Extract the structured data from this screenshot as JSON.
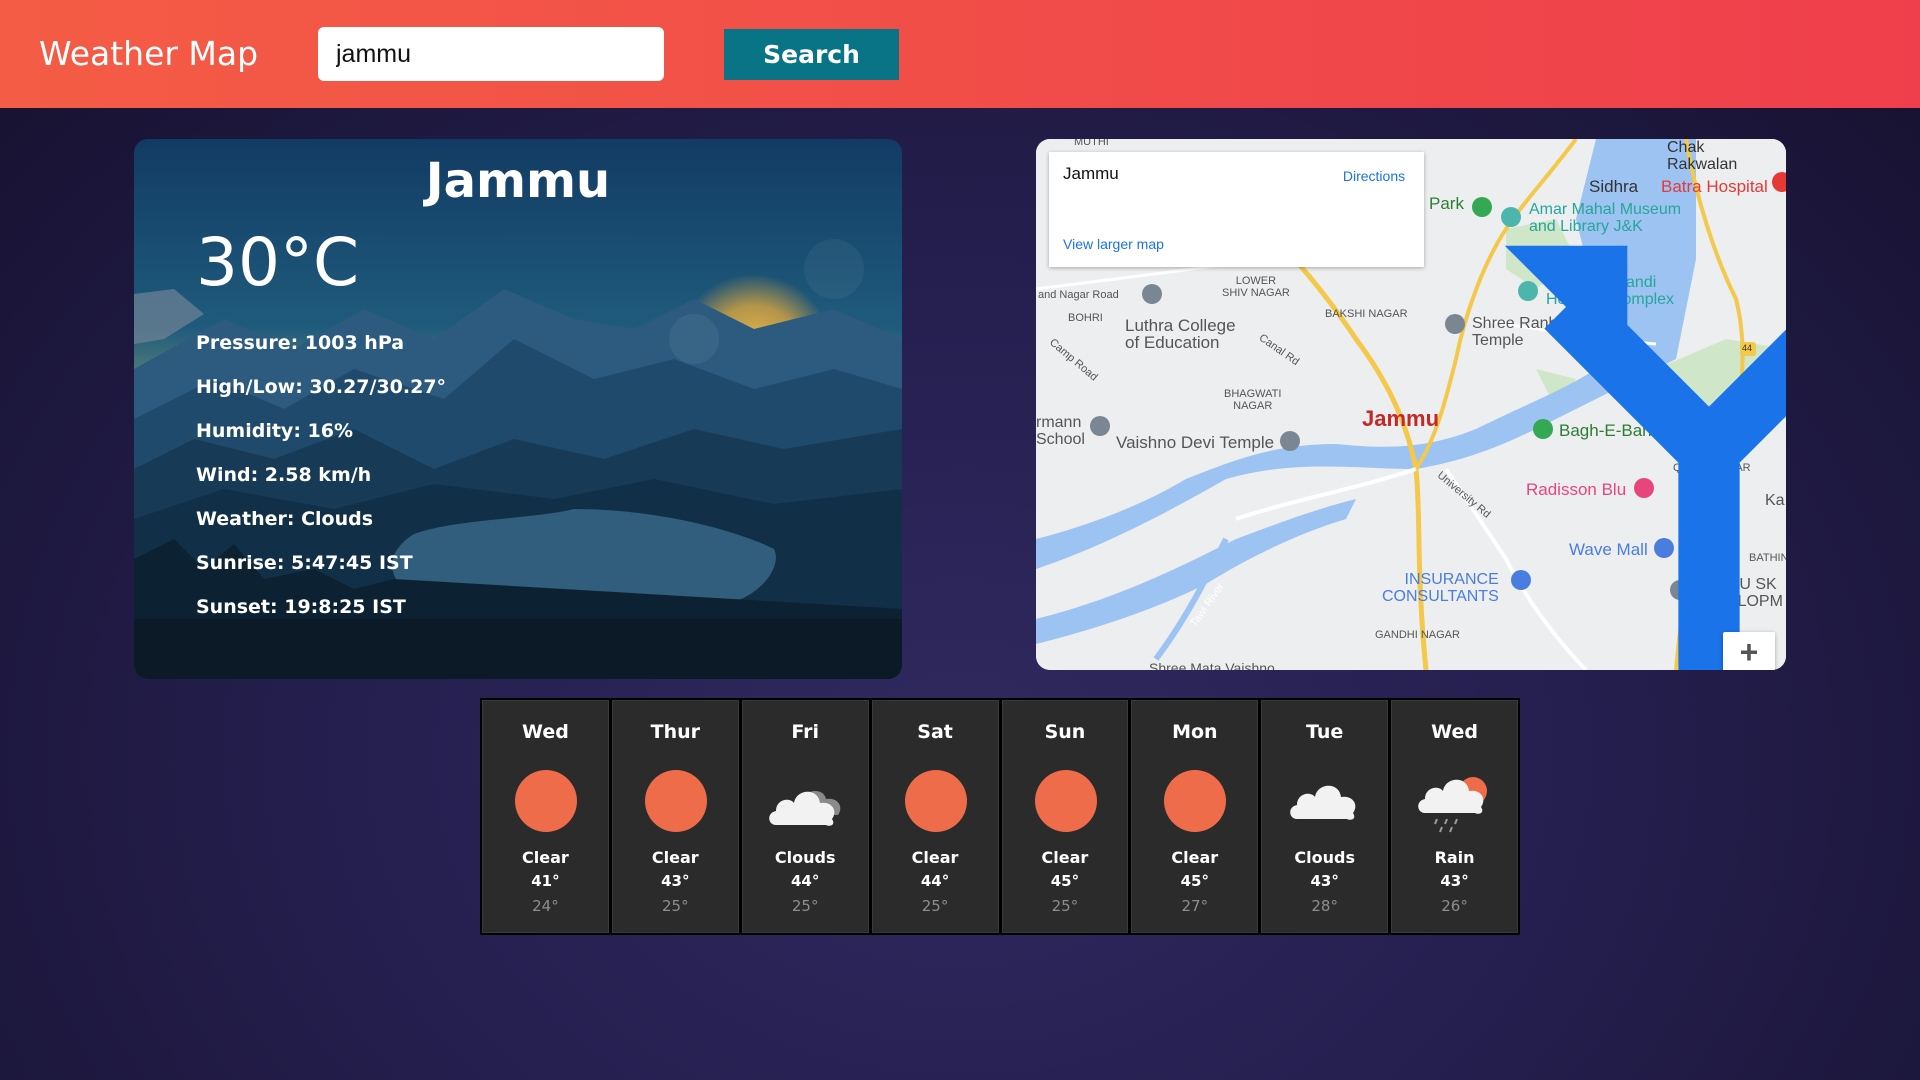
{
  "header": {
    "brand": "Weather Map",
    "search_value": "jammu",
    "search_button": "Search",
    "accent_color": "#ef3f4c",
    "button_color": "#0a7487"
  },
  "current": {
    "city": "Jammu",
    "temperature": "30°C",
    "pressure": "Pressure: 1003 hPa",
    "high_low": "High/Low: 30.27/30.27°",
    "humidity": "Humidity: 16%",
    "wind": "Wind: 2.58 km/h",
    "weather": "Weather: Clouds",
    "sunrise": "Sunrise: 5:47:45 IST",
    "sunset": "Sunset: 19:8:25 IST"
  },
  "map": {
    "place_title": "Jammu",
    "directions_label": "Directions",
    "view_larger": "View larger map",
    "zoom_in": "+",
    "labels": {
      "chak_rakwalan": "Chak\nRakwalan",
      "sidhra": "Sidhra",
      "batra": "Batra Hospital",
      "park": "Park",
      "amar_mahal": "Amar Mahal Museum\nand Library J&K",
      "mubarak": "Mubarak Mandi\nHeritage Complex",
      "lower_shiv": "LOWER\nSHIV NAGAR",
      "bakshi": "BAKSHI NAGAR",
      "ranbireshwar": "Shree Ranbireshwar\nTemple",
      "bohri": "BOHRI",
      "nagar_road": "and Nagar Road",
      "luthra": "Luthra College\nof Education",
      "canal_rd": "Canal Rd",
      "camp_road": "Camp Road",
      "bhagwati": "BHAGWATI\nNAGAR",
      "jammu": "Jammu",
      "bagh": "Bagh-E-Bahu",
      "rmann": "rmann\nSchool",
      "vaishno": "Vaishno Devi Temple",
      "qasim": "QASIM NAGAR",
      "university_rd": "University Rd",
      "radisson": "Radisson Blu",
      "ka": "Ka",
      "wave": "Wave Mall",
      "bathin": "BATHIND",
      "insurance": "INSURANCE\nCONSULTANTS",
      "jammu_sk": "JAMMU SK\nDEVELOPM",
      "tawi": "Tawi River",
      "gandhi": "GANDHI NAGAR",
      "muthi": "MUTHI",
      "mata": "Shree Mata Vaishno",
      "hw44": "44"
    }
  },
  "forecast": [
    {
      "day": "Wed",
      "condition": "Clear",
      "high": "41°",
      "low": "24°",
      "icon": "sun-icon"
    },
    {
      "day": "Thur",
      "condition": "Clear",
      "high": "43°",
      "low": "25°",
      "icon": "sun-icon"
    },
    {
      "day": "Fri",
      "condition": "Clouds",
      "high": "44°",
      "low": "25°",
      "icon": "broken-clouds-icon"
    },
    {
      "day": "Sat",
      "condition": "Clear",
      "high": "44°",
      "low": "25°",
      "icon": "sun-icon"
    },
    {
      "day": "Sun",
      "condition": "Clear",
      "high": "45°",
      "low": "25°",
      "icon": "sun-icon"
    },
    {
      "day": "Mon",
      "condition": "Clear",
      "high": "45°",
      "low": "27°",
      "icon": "sun-icon"
    },
    {
      "day": "Tue",
      "condition": "Clouds",
      "high": "43°",
      "low": "28°",
      "icon": "cloud-icon"
    },
    {
      "day": "Wed",
      "condition": "Rain",
      "high": "43°",
      "low": "26°",
      "icon": "rain-icon"
    }
  ]
}
